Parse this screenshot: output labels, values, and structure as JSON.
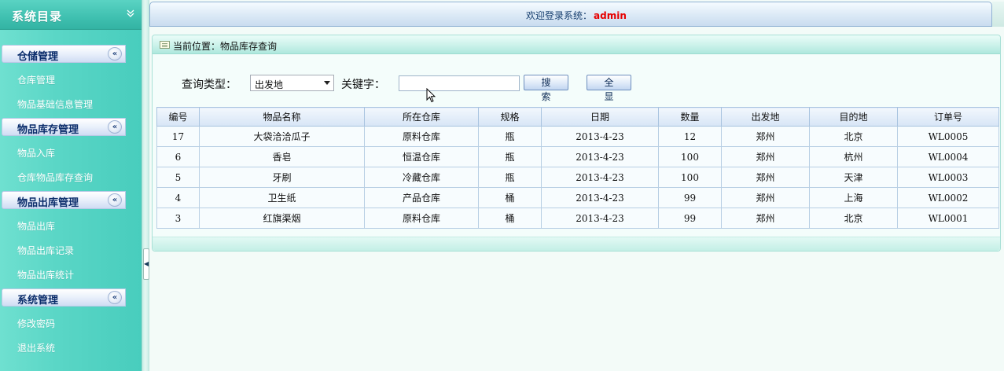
{
  "sidebar": {
    "title": "系统目录",
    "collapse_icon": "double-chevron-down-icon",
    "groups": [
      {
        "label": "仓储管理",
        "toggle": "«",
        "items": [
          "仓库管理",
          "物品基础信息管理"
        ]
      },
      {
        "label": "物品库存管理",
        "toggle": "«",
        "items": [
          "物品入库",
          "仓库物品库存查询"
        ]
      },
      {
        "label": "物品出库管理",
        "toggle": "«",
        "items": [
          "物品出库",
          "物品出库记录",
          "物品出库统计"
        ]
      },
      {
        "label": "系统管理",
        "toggle": "«",
        "items": [
          "修改密码",
          "退出系统"
        ]
      }
    ]
  },
  "header": {
    "welcome": "欢迎登录系统：",
    "user": "admin"
  },
  "location": {
    "icon": "page-icon",
    "text": "当前位置：物品库存查询"
  },
  "search": {
    "type_label": "查询类型：",
    "type_value": "出发地",
    "keyword_label": "关键字：",
    "keyword_value": "",
    "search_button": "搜 索",
    "show_all_button": "全 显"
  },
  "table": {
    "columns": [
      "编号",
      "物品名称",
      "所在仓库",
      "规格",
      "日期",
      "数量",
      "出发地",
      "目的地",
      "订单号"
    ],
    "rows": [
      [
        "17",
        "大袋洽洽瓜子",
        "原料仓库",
        "瓶",
        "2013-4-23",
        "12",
        "郑州",
        "北京",
        "WL0005"
      ],
      [
        "6",
        "香皂",
        "恒温仓库",
        "瓶",
        "2013-4-23",
        "100",
        "郑州",
        "杭州",
        "WL0004"
      ],
      [
        "5",
        "牙刷",
        "冷藏仓库",
        "瓶",
        "2013-4-23",
        "100",
        "郑州",
        "天津",
        "WL0003"
      ],
      [
        "4",
        "卫生纸",
        "产品仓库",
        "桶",
        "2013-4-23",
        "99",
        "郑州",
        "上海",
        "WL0002"
      ],
      [
        "3",
        "红旗渠烟",
        "原料仓库",
        "桶",
        "2013-4-23",
        "99",
        "郑州",
        "北京",
        "WL0001"
      ]
    ]
  },
  "colors": {
    "sidebar": "#55d4c4",
    "accent_user": "#e60000",
    "group_header_text": "#0b2d6b"
  }
}
